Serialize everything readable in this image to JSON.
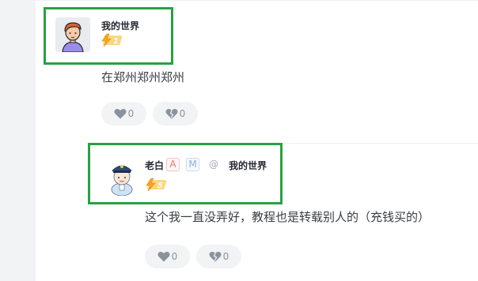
{
  "comments": [
    {
      "username": "我的世界",
      "level": "1",
      "text": "在郑州郑州郑州",
      "like_count": "0",
      "dislike_count": "0",
      "icons": {
        "avatar": "cartoon-boy-avatar",
        "level": "lightning-level-badge",
        "like": "heart-icon",
        "dislike": "broken-heart-icon"
      }
    },
    {
      "username": "老白",
      "tag_a": "A",
      "tag_m": "M",
      "at_symbol": "@",
      "reply_to": "我的世界",
      "level": "5",
      "text": "这个我一直没弄好，教程也是转载别人的（充钱买的）",
      "like_count": "0",
      "dislike_count": "0",
      "icons": {
        "avatar": "police-cartoon-avatar",
        "level": "lightning-level-badge",
        "like": "heart-icon",
        "dislike": "broken-heart-icon"
      }
    }
  ],
  "colors": {
    "highlight": "#27a244",
    "badge_orange": "#f5a623",
    "text": "#252933",
    "muted": "#8a919f",
    "button_bg": "#f2f3f5"
  }
}
